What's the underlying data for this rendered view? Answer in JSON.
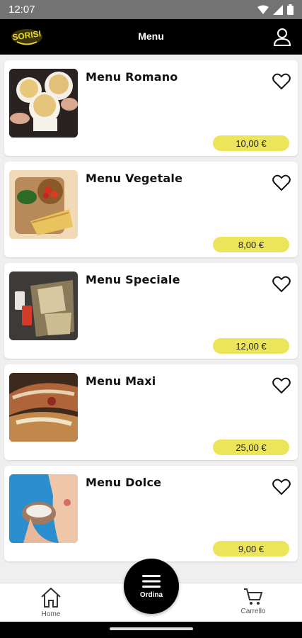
{
  "status_bar": {
    "time": "12:07"
  },
  "header": {
    "title": "Menu",
    "logo_text": "SORISI"
  },
  "menus": [
    {
      "name": "Menu Romano",
      "price": "10,00 €"
    },
    {
      "name": "Menu Vegetale",
      "price": "8,00 €"
    },
    {
      "name": "Menu Speciale",
      "price": "12,00 €"
    },
    {
      "name": "Menu Maxi",
      "price": "25,00 €"
    },
    {
      "name": "Menu Dolce",
      "price": "9,00 €"
    }
  ],
  "bottom_nav": {
    "home_label": "Home",
    "order_label": "Ordina",
    "cart_label": "Carrello"
  },
  "colors": {
    "accent": "#ece55a",
    "header": "#000000",
    "status_bar": "#737373"
  },
  "icons": [
    "wifi-icon",
    "signal-icon",
    "battery-icon",
    "profile-icon",
    "heart-icon",
    "home-icon",
    "menu-icon",
    "cart-icon"
  ]
}
